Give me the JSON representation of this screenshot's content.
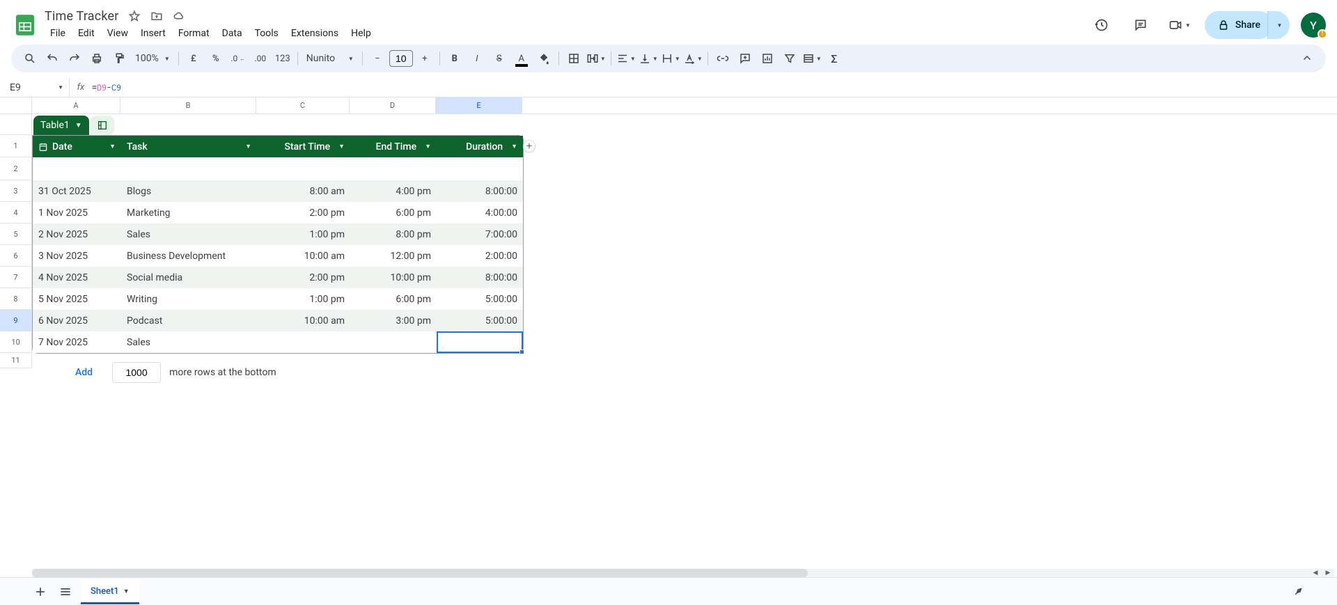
{
  "doc": {
    "title": "Time Tracker"
  },
  "menu": {
    "file": "File",
    "edit": "Edit",
    "view": "View",
    "insert": "Insert",
    "format": "Format",
    "data": "Data",
    "tools": "Tools",
    "extensions": "Extensions",
    "help": "Help"
  },
  "share": {
    "label": "Share"
  },
  "avatar": {
    "initial": "Y"
  },
  "toolbar": {
    "zoom": "100%",
    "font": "Nunito",
    "font_size": "10",
    "more_formats": "123"
  },
  "namebox": {
    "value": "E9"
  },
  "formula": {
    "prefix": "=",
    "ref1": "D9",
    "op": "-",
    "ref2": "C9"
  },
  "columns": {
    "A": "A",
    "B": "B",
    "C": "C",
    "D": "D",
    "E": "E"
  },
  "col_widths": {
    "A": 127,
    "B": 195,
    "C": 134,
    "D": 124,
    "E": 124
  },
  "row_labels": [
    "1",
    "2",
    "3",
    "4",
    "5",
    "6",
    "7",
    "8",
    "9",
    "10",
    "11"
  ],
  "table": {
    "chip": "Table1",
    "headers": {
      "date": "Date",
      "task": "Task",
      "start": "Start Time",
      "end": "End Time",
      "dur": "Duration"
    },
    "rows": [
      {
        "date": "",
        "task": "",
        "start": "",
        "end": "",
        "dur": ""
      },
      {
        "date": "31 Oct 2025",
        "task": "Blogs",
        "start": "8:00 am",
        "end": "4:00 pm",
        "dur": "8:00:00"
      },
      {
        "date": "1 Nov 2025",
        "task": "Marketing",
        "start": "2:00 pm",
        "end": "6:00 pm",
        "dur": "4:00:00"
      },
      {
        "date": "2 Nov 2025",
        "task": "Sales",
        "start": "1:00 pm",
        "end": "8:00 pm",
        "dur": "7:00:00"
      },
      {
        "date": "3 Nov 2025",
        "task": "Business Development",
        "start": "10:00 am",
        "end": "12:00 pm",
        "dur": "2:00:00"
      },
      {
        "date": "4 Nov 2025",
        "task": "Social media",
        "start": "2:00 pm",
        "end": "10:00 pm",
        "dur": "8:00:00"
      },
      {
        "date": "5 Nov 2025",
        "task": "Writing",
        "start": "1:00 pm",
        "end": "6:00 pm",
        "dur": "5:00:00"
      },
      {
        "date": "6 Nov 2025",
        "task": "Podcast",
        "start": "10:00 am",
        "end": "3:00 pm",
        "dur": "5:00:00"
      },
      {
        "date": "7 Nov 2025",
        "task": "Sales",
        "start": "",
        "end": "",
        "dur": ""
      }
    ]
  },
  "add_rows": {
    "button": "Add",
    "count": "1000",
    "suffix": "more rows at the bottom"
  },
  "sheets": {
    "active": "Sheet1"
  },
  "selection": {
    "cell": "E9",
    "row_index": 9,
    "col": "E"
  }
}
